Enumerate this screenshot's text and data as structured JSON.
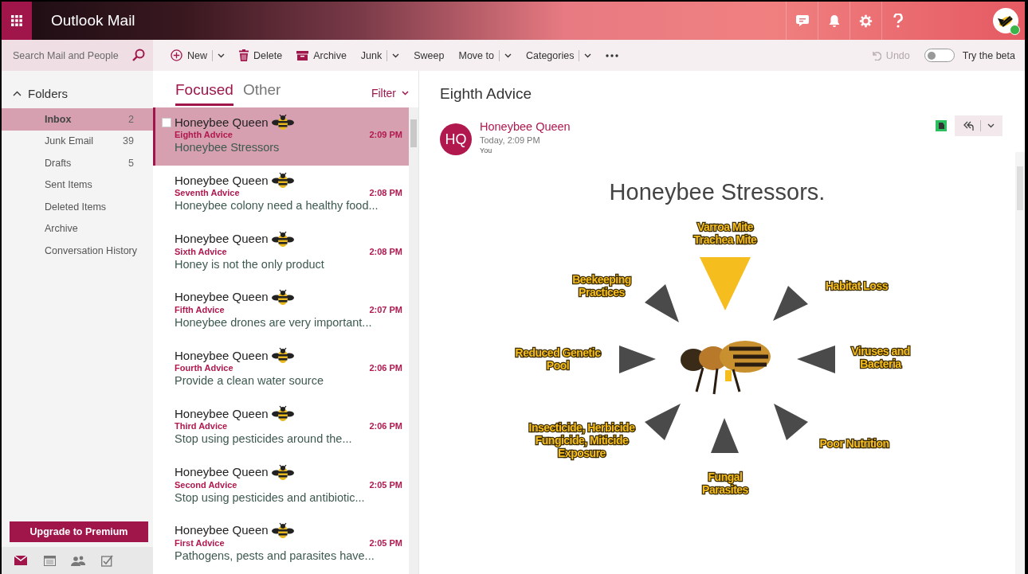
{
  "header": {
    "app_title": "Outlook Mail"
  },
  "toolbar": {
    "search": {
      "placeholder": "Search Mail and People"
    },
    "actions": [
      {
        "label": "New",
        "kind": "new",
        "dropdown": true
      },
      {
        "label": "Delete",
        "kind": "delete",
        "dropdown": false
      },
      {
        "label": "Archive",
        "kind": "archive",
        "dropdown": false
      },
      {
        "label": "Junk",
        "kind": "plain",
        "dropdown": true
      },
      {
        "label": "Sweep",
        "kind": "plain",
        "dropdown": false
      },
      {
        "label": "Move to",
        "kind": "plain",
        "dropdown": true
      },
      {
        "label": "Categories",
        "kind": "plain",
        "dropdown": true
      }
    ],
    "undo": {
      "label": "Undo",
      "disabled": true
    },
    "beta_toggle": {
      "label": "Try the beta",
      "on": false
    }
  },
  "folders": {
    "title": "Folders",
    "expanded": true,
    "items": [
      {
        "name": "Inbox",
        "count": "2",
        "selected": true
      },
      {
        "name": "Junk Email",
        "count": "39",
        "selected": false
      },
      {
        "name": "Drafts",
        "count": "5",
        "selected": false
      },
      {
        "name": "Sent Items",
        "selected": false
      },
      {
        "name": "Deleted Items",
        "selected": false
      },
      {
        "name": "Archive",
        "selected": false
      },
      {
        "name": "Conversation History",
        "selected": false
      }
    ]
  },
  "upgrade_button": "Upgrade to Premium",
  "nav_modules": [
    {
      "kind": "mail",
      "selected": true
    },
    {
      "kind": "calendar",
      "selected": false
    },
    {
      "kind": "people",
      "selected": false
    },
    {
      "kind": "tasks",
      "selected": false
    }
  ],
  "message_list": {
    "tabs": [
      {
        "label": "Focused",
        "selected": true
      },
      {
        "label": "Other",
        "selected": false
      }
    ],
    "filter": "Filter",
    "messages": [
      {
        "sender": "Honeybee Queen",
        "subject": "Eighth Advice",
        "time": "2:09 PM",
        "preview": "Honeybee Stressors",
        "selected": true
      },
      {
        "sender": "Honeybee Queen",
        "subject": "Seventh Advice",
        "time": "2:08 PM",
        "preview": "Honeybee colony need a healthy food...",
        "selected": false
      },
      {
        "sender": "Honeybee Queen",
        "subject": "Sixth Advice",
        "time": "2:08 PM",
        "preview": "Honey is not the only product",
        "selected": false
      },
      {
        "sender": "Honeybee Queen",
        "subject": "Fifth Advice",
        "time": "2:07 PM",
        "preview": "Honeybee drones are very important...",
        "selected": false
      },
      {
        "sender": "Honeybee Queen",
        "subject": "Fourth Advice",
        "time": "2:06 PM",
        "preview": "Provide a clean water source",
        "selected": false
      },
      {
        "sender": "Honeybee Queen",
        "subject": "Third Advice",
        "time": "2:06 PM",
        "preview": "Stop using pesticides around the...",
        "selected": false
      },
      {
        "sender": "Honeybee Queen",
        "subject": "Second Advice",
        "time": "2:05 PM",
        "preview": "Stop using pesticides and antibiotic...",
        "selected": false
      },
      {
        "sender": "Honeybee Queen",
        "subject": "First Advice",
        "time": "2:05 PM",
        "preview": "Pathogens, pests and parasites have...",
        "selected": false
      }
    ]
  },
  "reading_pane": {
    "subject": "Eighth Advice",
    "sender_initials": "HQ",
    "sender": "Honeybee Queen",
    "date": "Today, 2:09 PM",
    "recipient": "You",
    "diagram": {
      "title": "Honeybee Stressors.",
      "stressors": [
        {
          "lines": [
            "Varroa Mite",
            "Trachea Mite"
          ],
          "highlighted": true
        },
        {
          "lines": [
            "Beekeeping",
            "Practices"
          ],
          "highlighted": false
        },
        {
          "lines": [
            "Habitat Loss"
          ],
          "highlighted": false
        },
        {
          "lines": [
            "Reduced Genetic",
            "Pool"
          ],
          "highlighted": false
        },
        {
          "lines": [
            "Viruses and",
            "Bacteria"
          ],
          "highlighted": false
        },
        {
          "lines": [
            "Insecticide, Herbicide",
            "Fungicide, Miticide",
            "Exposure"
          ],
          "highlighted": false
        },
        {
          "lines": [
            "Poor Nutrition"
          ],
          "highlighted": false
        },
        {
          "lines": [
            "Fungal",
            "Parasites"
          ],
          "highlighted": false
        }
      ]
    }
  }
}
